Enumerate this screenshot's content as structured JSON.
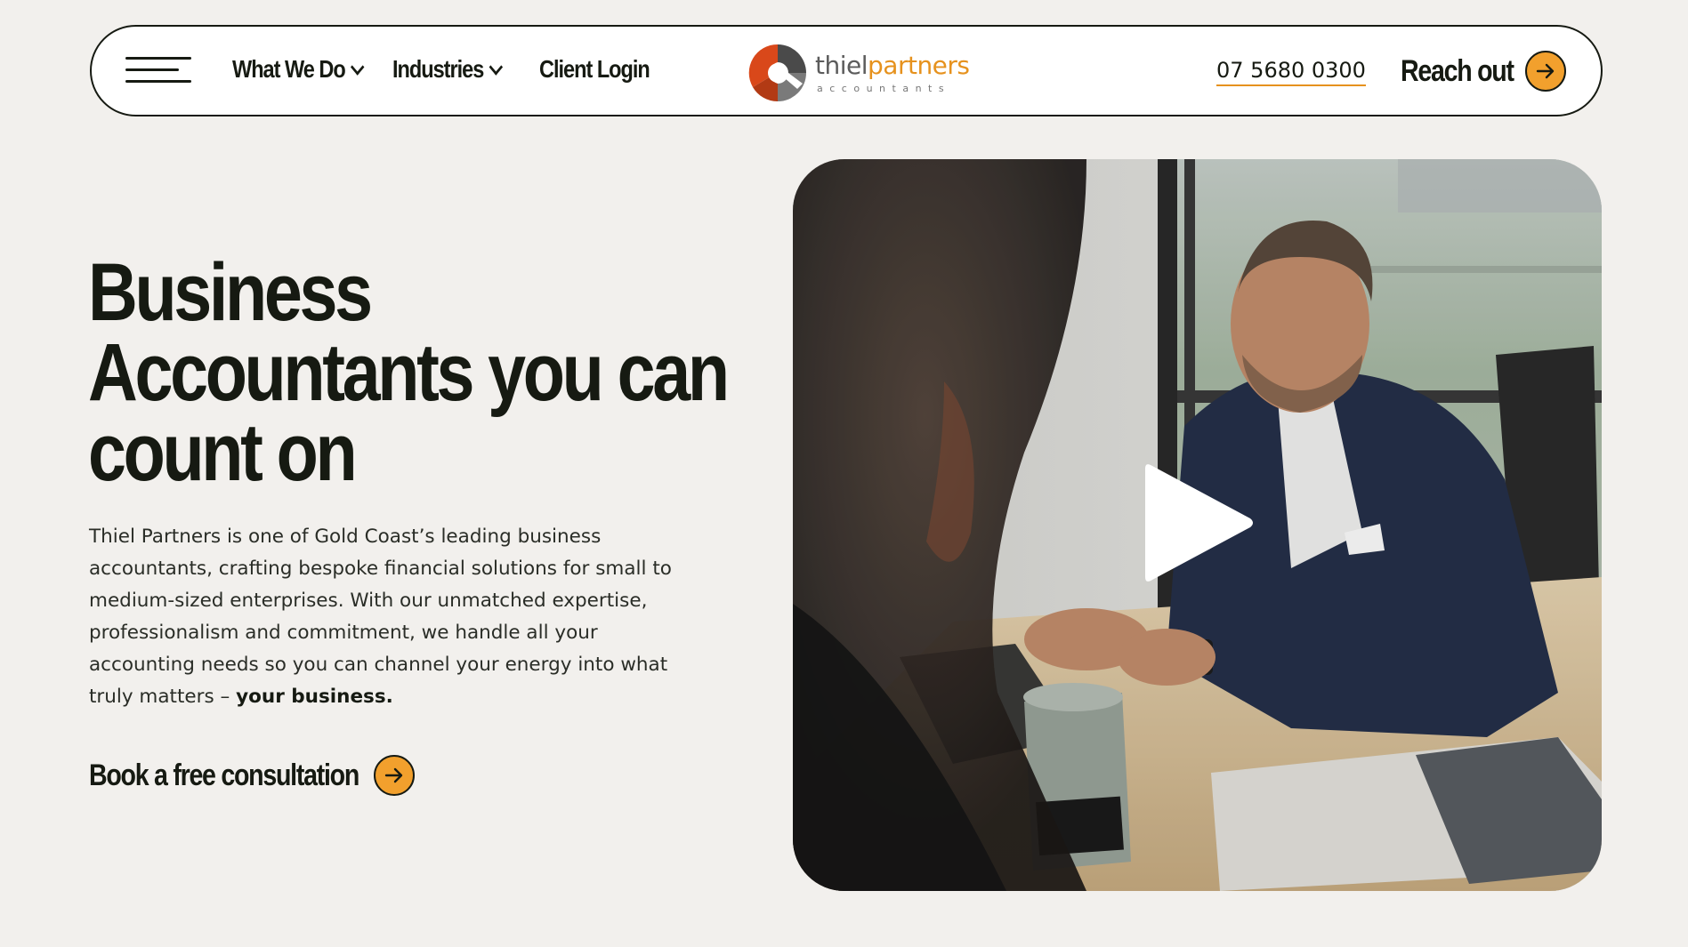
{
  "header": {
    "menu_icon": "hamburger-menu-icon",
    "nav": [
      {
        "label": "What We Do",
        "has_dropdown": true
      },
      {
        "label": "Industries",
        "has_dropdown": true
      },
      {
        "label": "Client Login",
        "has_dropdown": false
      }
    ],
    "logo": {
      "word_a": "thiel",
      "word_b": "partners",
      "sub": "accountants"
    },
    "phone": "07 5680 0300",
    "cta_label": "Reach out",
    "cta_icon": "arrow-right-icon"
  },
  "hero": {
    "title_lines": [
      "Business",
      "Accountants you can",
      "count on"
    ],
    "body": "Thiel Partners is one of Gold Coast’s leading business accountants, crafting bespoke financial solutions for small to medium-sized enterprises. With our unmatched expertise, professionalism and commitment, we handle all your accounting needs so you can channel your energy into what truly matters –",
    "body_strong": "your business.",
    "cta_label": "Book a free consultation",
    "cta_icon": "arrow-right-icon"
  },
  "video": {
    "play_icon": "play-icon"
  },
  "colors": {
    "background": "#f2f0ed",
    "text": "#161a12",
    "accent": "#f2a02d",
    "logo_orange": "#e6921e"
  }
}
